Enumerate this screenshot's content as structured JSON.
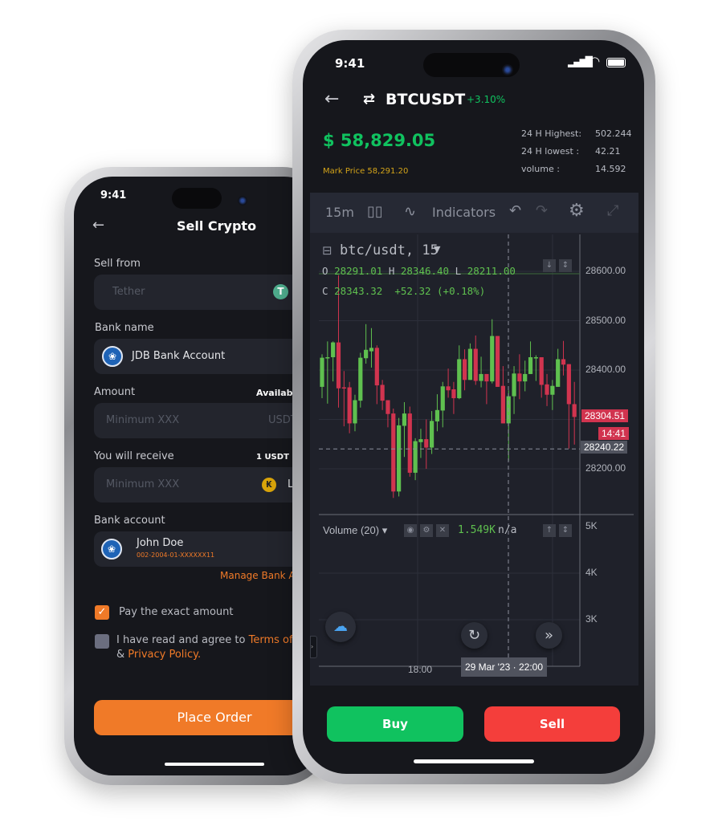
{
  "left_phone": {
    "status_time": "9:41",
    "title": "Sell Crypto",
    "sell_from": {
      "label": "Sell from",
      "placeholder": "Tether",
      "coin_icon": "tether-icon"
    },
    "bank_name": {
      "label": "Bank name",
      "value": "JDB Bank Account"
    },
    "amount": {
      "label": "Amount",
      "available": "Availab",
      "placeholder": "Minimum XXX",
      "unit": "USDT"
    },
    "receive": {
      "label": "You will receive",
      "rate": "1 USDT ~",
      "placeholder": "Minimum XXX",
      "unit": "L"
    },
    "bank_account": {
      "label": "Bank account",
      "name": "John Doe",
      "number": "002-2004-01-XXXXXX11",
      "manage": "Manage Bank A"
    },
    "pay_exact": {
      "label": "Pay the exact amount",
      "checked": true
    },
    "agree": {
      "text": "I have read and agree to",
      "terms": "Terms of",
      "amp": "&",
      "privacy": "Privacy Policy.",
      "checked": false
    },
    "place_order": "Place Order",
    "accent": "#f07a28"
  },
  "right_phone": {
    "status_time": "9:41",
    "pair": "BTCUSDT",
    "change": "+3.10%",
    "price": "$ 58,829.05",
    "mark_price": "Mark Price 58,291.20",
    "stats": [
      {
        "label": "24 H Highest:",
        "value": "502.244"
      },
      {
        "label": "24 H lowest :",
        "value": "42.21"
      },
      {
        "label": "volume :",
        "value": "14.592"
      }
    ],
    "toolbar": {
      "interval": "15m",
      "indicators": "Indicators"
    },
    "chart": {
      "symbol": "btc/usdt, 15",
      "ohlc": {
        "o_label": "O",
        "o": "28291.01",
        "h_label": "H",
        "h": "28346.40",
        "l_label": "L",
        "l": "28211.00",
        "c_label": "C",
        "c": "28343.32",
        "change": "+52.32 (+0.18%)"
      },
      "price_ticks": [
        "28600.00",
        "28500.00",
        "28400.00",
        "28200.00"
      ],
      "last_price_tag": "28304.51",
      "countdown_tag": "14:41",
      "crosshair_price": "28240.22",
      "volume_label": "Volume (20)",
      "volume_value": "1.549K",
      "volume_na": "n/a",
      "volume_ticks": [
        "5K",
        "4K",
        "3K"
      ],
      "time_tick": "18:00",
      "crosshair_time": "29 Mar '23 · 22:00",
      "up_color": "#5fc04f",
      "down_color": "#d1344f",
      "candles_ohlc": [
        [
          28366,
          28432,
          28343,
          28425
        ],
        [
          28424,
          28458,
          28332,
          28426
        ],
        [
          28426,
          28458,
          28377,
          28456
        ],
        [
          28456,
          28592,
          28324,
          28363
        ],
        [
          28365,
          28398,
          28286,
          28363
        ],
        [
          28365,
          28376,
          28272,
          28292
        ],
        [
          28292,
          28350,
          28276,
          28339
        ],
        [
          28338,
          28435,
          28324,
          28425
        ],
        [
          28424,
          28493,
          28413,
          28441
        ],
        [
          28438,
          28485,
          28405,
          28445
        ],
        [
          28445,
          28450,
          28331,
          28369
        ],
        [
          28370,
          28380,
          28319,
          28338
        ],
        [
          28339,
          28339,
          28284,
          28311
        ],
        [
          28312,
          28322,
          28141,
          28154
        ],
        [
          28154,
          28303,
          28144,
          28288
        ],
        [
          28287,
          28335,
          28224,
          28312
        ],
        [
          28312,
          28326,
          28184,
          28192
        ],
        [
          28192,
          28262,
          28177,
          28256
        ],
        [
          28254,
          28281,
          28222,
          28260
        ],
        [
          28260,
          28300,
          28200,
          28243
        ],
        [
          28243,
          28317,
          28230,
          28297
        ],
        [
          28296,
          28351,
          28276,
          28319
        ],
        [
          28318,
          28376,
          28284,
          28367
        ],
        [
          28367,
          28403,
          28344,
          28359
        ],
        [
          28361,
          28376,
          28311,
          28343
        ],
        [
          28343,
          28450,
          28341,
          28422
        ],
        [
          28422,
          28442,
          28359,
          28380
        ],
        [
          28380,
          28454,
          28380,
          28443
        ],
        [
          28443,
          28470,
          28370,
          28378
        ],
        [
          28378,
          28427,
          28365,
          28392
        ],
        [
          28392,
          28392,
          28331,
          28377
        ],
        [
          28377,
          28503,
          28373,
          28469
        ],
        [
          28469,
          28469,
          28366,
          28366
        ],
        [
          28368,
          28408,
          28292,
          28292
        ],
        [
          28292,
          28359,
          28216,
          28347
        ],
        [
          28347,
          28408,
          28311,
          28393
        ],
        [
          28393,
          28432,
          28341,
          28377
        ],
        [
          28377,
          28419,
          28357,
          28392
        ],
        [
          28392,
          28458,
          28392,
          28426
        ],
        [
          28424,
          28430,
          28378,
          28426
        ],
        [
          28426,
          28426,
          28344,
          28370
        ],
        [
          28371,
          28392,
          28327,
          28350
        ],
        [
          28350,
          28380,
          28319,
          28368
        ],
        [
          28366,
          28443,
          28366,
          28422
        ],
        [
          28422,
          28459,
          28389,
          28411
        ],
        [
          28412,
          28412,
          28241,
          28331
        ],
        [
          28331,
          28376,
          28249,
          28305
        ]
      ]
    },
    "buy": "Buy",
    "sell": "Sell",
    "buy_color": "#10c25f",
    "sell_color": "#f43e3b"
  }
}
